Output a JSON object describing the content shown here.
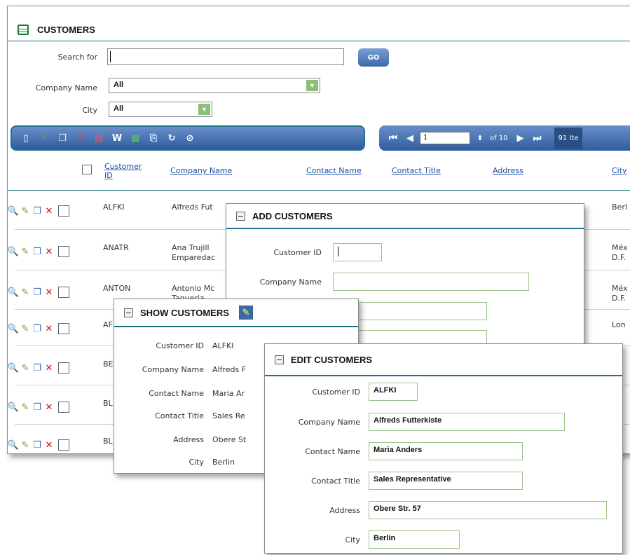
{
  "main": {
    "title": "CUSTOMERS",
    "search_label": "Search for",
    "search_value": "",
    "go_label": "GO",
    "company_filter_label": "Company Name",
    "company_filter_value": "All",
    "city_filter_label": "City",
    "city_filter_value": "All",
    "pager": {
      "page": "1",
      "of_label": "of 10",
      "items_label": "91 Ite"
    },
    "columns": [
      "Customer ID",
      "Company Name",
      "Contact Name",
      "Contact Title",
      "Address",
      "City"
    ],
    "rows": [
      {
        "id": "ALFKI",
        "company": "Alfreds Fut",
        "city": "Berl"
      },
      {
        "id": "ANATR",
        "company": "Ana Trujill Emparedac",
        "city": "Méx D.F."
      },
      {
        "id": "ANTON",
        "company": "Antonio Mc Taqueria",
        "city": "Méx D.F."
      },
      {
        "id": "AF",
        "company": "",
        "city": "Lon"
      },
      {
        "id": "BE",
        "company": "",
        "city": ""
      },
      {
        "id": "BL",
        "company": "",
        "city": ""
      },
      {
        "id": "BL",
        "company": "",
        "city": ""
      }
    ]
  },
  "add_panel": {
    "title": "ADD CUSTOMERS",
    "customer_id_label": "Customer ID",
    "company_name_label": "Company Name",
    "customer_id_value": "",
    "company_name_value": ""
  },
  "show_panel": {
    "title": "SHOW CUSTOMERS",
    "fields": [
      {
        "label": "Customer ID",
        "value": "ALFKI"
      },
      {
        "label": "Company Name",
        "value": "Alfreds F"
      },
      {
        "label": "Contact Name",
        "value": "Maria Ar"
      },
      {
        "label": "Contact Title",
        "value": "Sales Re"
      },
      {
        "label": "Address",
        "value": "Obere St"
      },
      {
        "label": "City",
        "value": "Berlin"
      }
    ]
  },
  "edit_panel": {
    "title": "EDIT CUSTOMERS",
    "fields": [
      {
        "label": "Customer ID",
        "value": "ALFKI"
      },
      {
        "label": "Company Name",
        "value": "Alfreds Futterkiste"
      },
      {
        "label": "Contact Name",
        "value": "Maria Anders"
      },
      {
        "label": "Contact Title",
        "value": "Sales Representative"
      },
      {
        "label": "Address",
        "value": "Obere Str. 57"
      },
      {
        "label": "City",
        "value": "Berlin"
      }
    ]
  },
  "icons": {
    "toolbar": [
      "new-icon",
      "edit-icon",
      "copy-icon",
      "delete-icon",
      "pdf-icon",
      "word-icon",
      "excel-icon",
      "import-icon",
      "refresh-icon",
      "clear-filter-icon"
    ],
    "row": [
      "view-icon",
      "edit-icon",
      "copy-icon",
      "delete-icon"
    ],
    "pager": [
      "first-page-icon",
      "prev-page-icon",
      "page-spinner-icon",
      "next-page-icon",
      "last-page-icon"
    ]
  },
  "colors": {
    "accent": "#1f6f8f",
    "toolbar": "#3d68a8",
    "field_border": "#9cc48a",
    "link": "#1a4f9c",
    "delete": "#d01010"
  }
}
